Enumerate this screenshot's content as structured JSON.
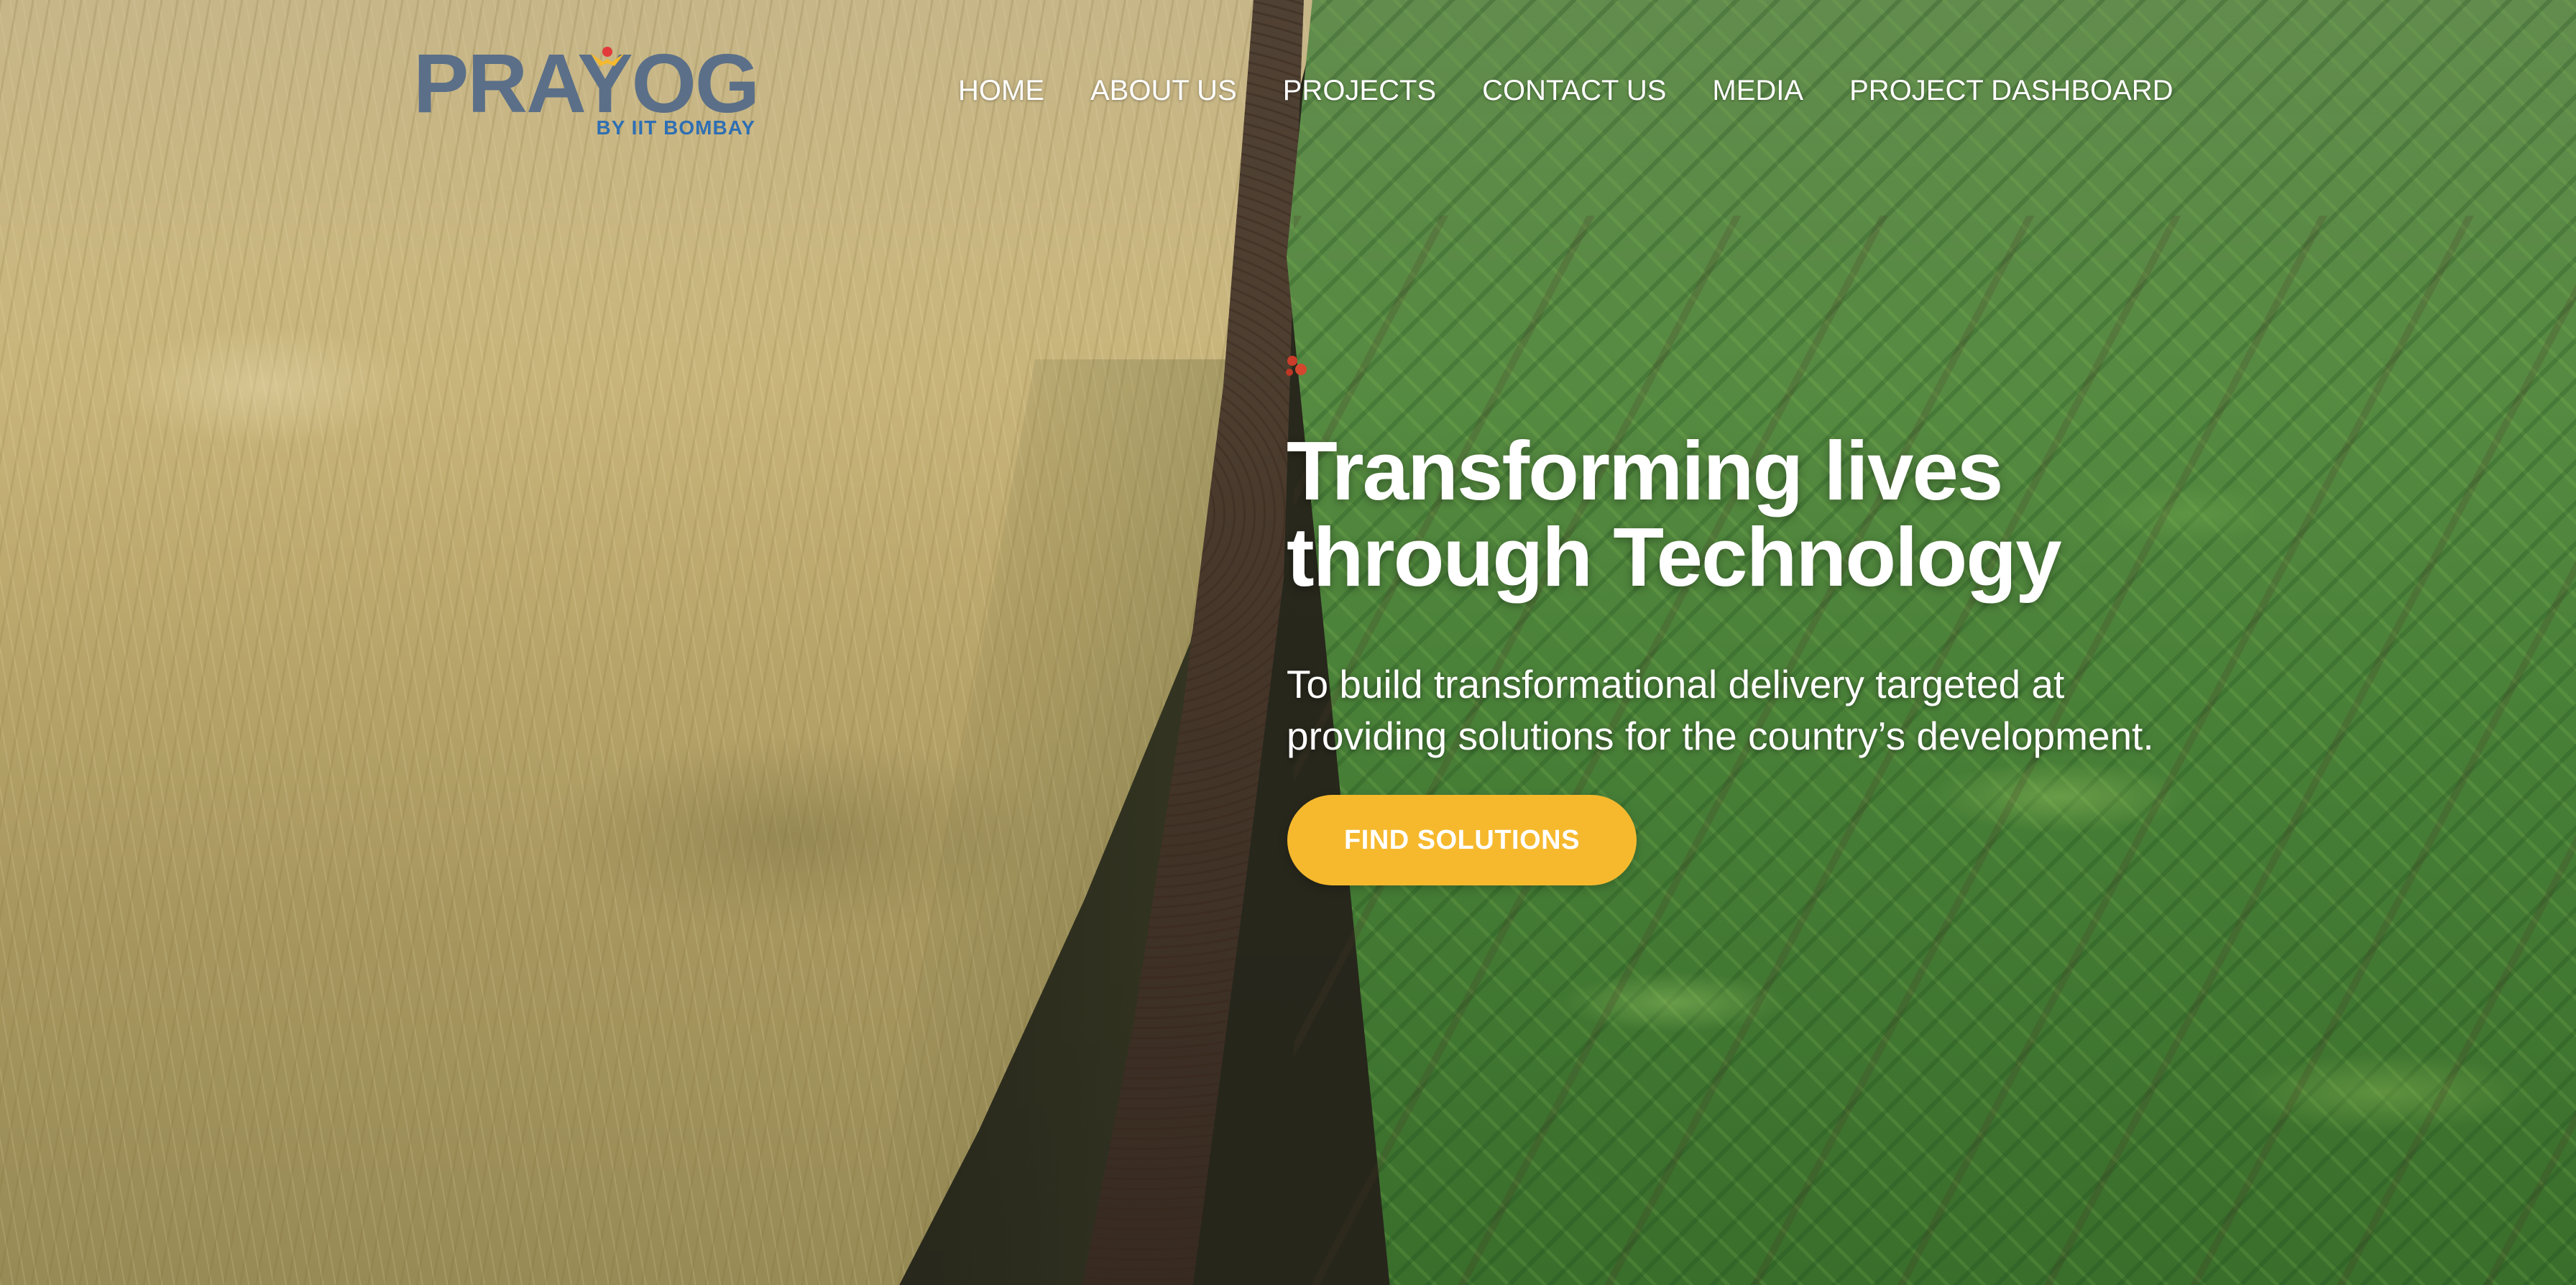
{
  "brand": {
    "name": "PRAYOG",
    "tagline": "BY IIT BOMBAY",
    "primary_color": "#5b6f88",
    "tagline_color": "#2f6fb3",
    "accent_color": "#f6b92e"
  },
  "nav": {
    "items": [
      {
        "label": "HOME"
      },
      {
        "label": "ABOUT US"
      },
      {
        "label": "PROJECTS"
      },
      {
        "label": "CONTACT US"
      },
      {
        "label": "MEDIA"
      },
      {
        "label": "PROJECT DASHBOARD"
      }
    ]
  },
  "hero": {
    "title_line1": "Transforming lives",
    "title_line2": "through Technology",
    "subtitle_line1": "To build transformational delivery targeted at",
    "subtitle_line2": "providing solutions for the country’s development.",
    "cta_label": "FIND SOLUTIONS",
    "background": "wheat-and-corn-field-image"
  }
}
